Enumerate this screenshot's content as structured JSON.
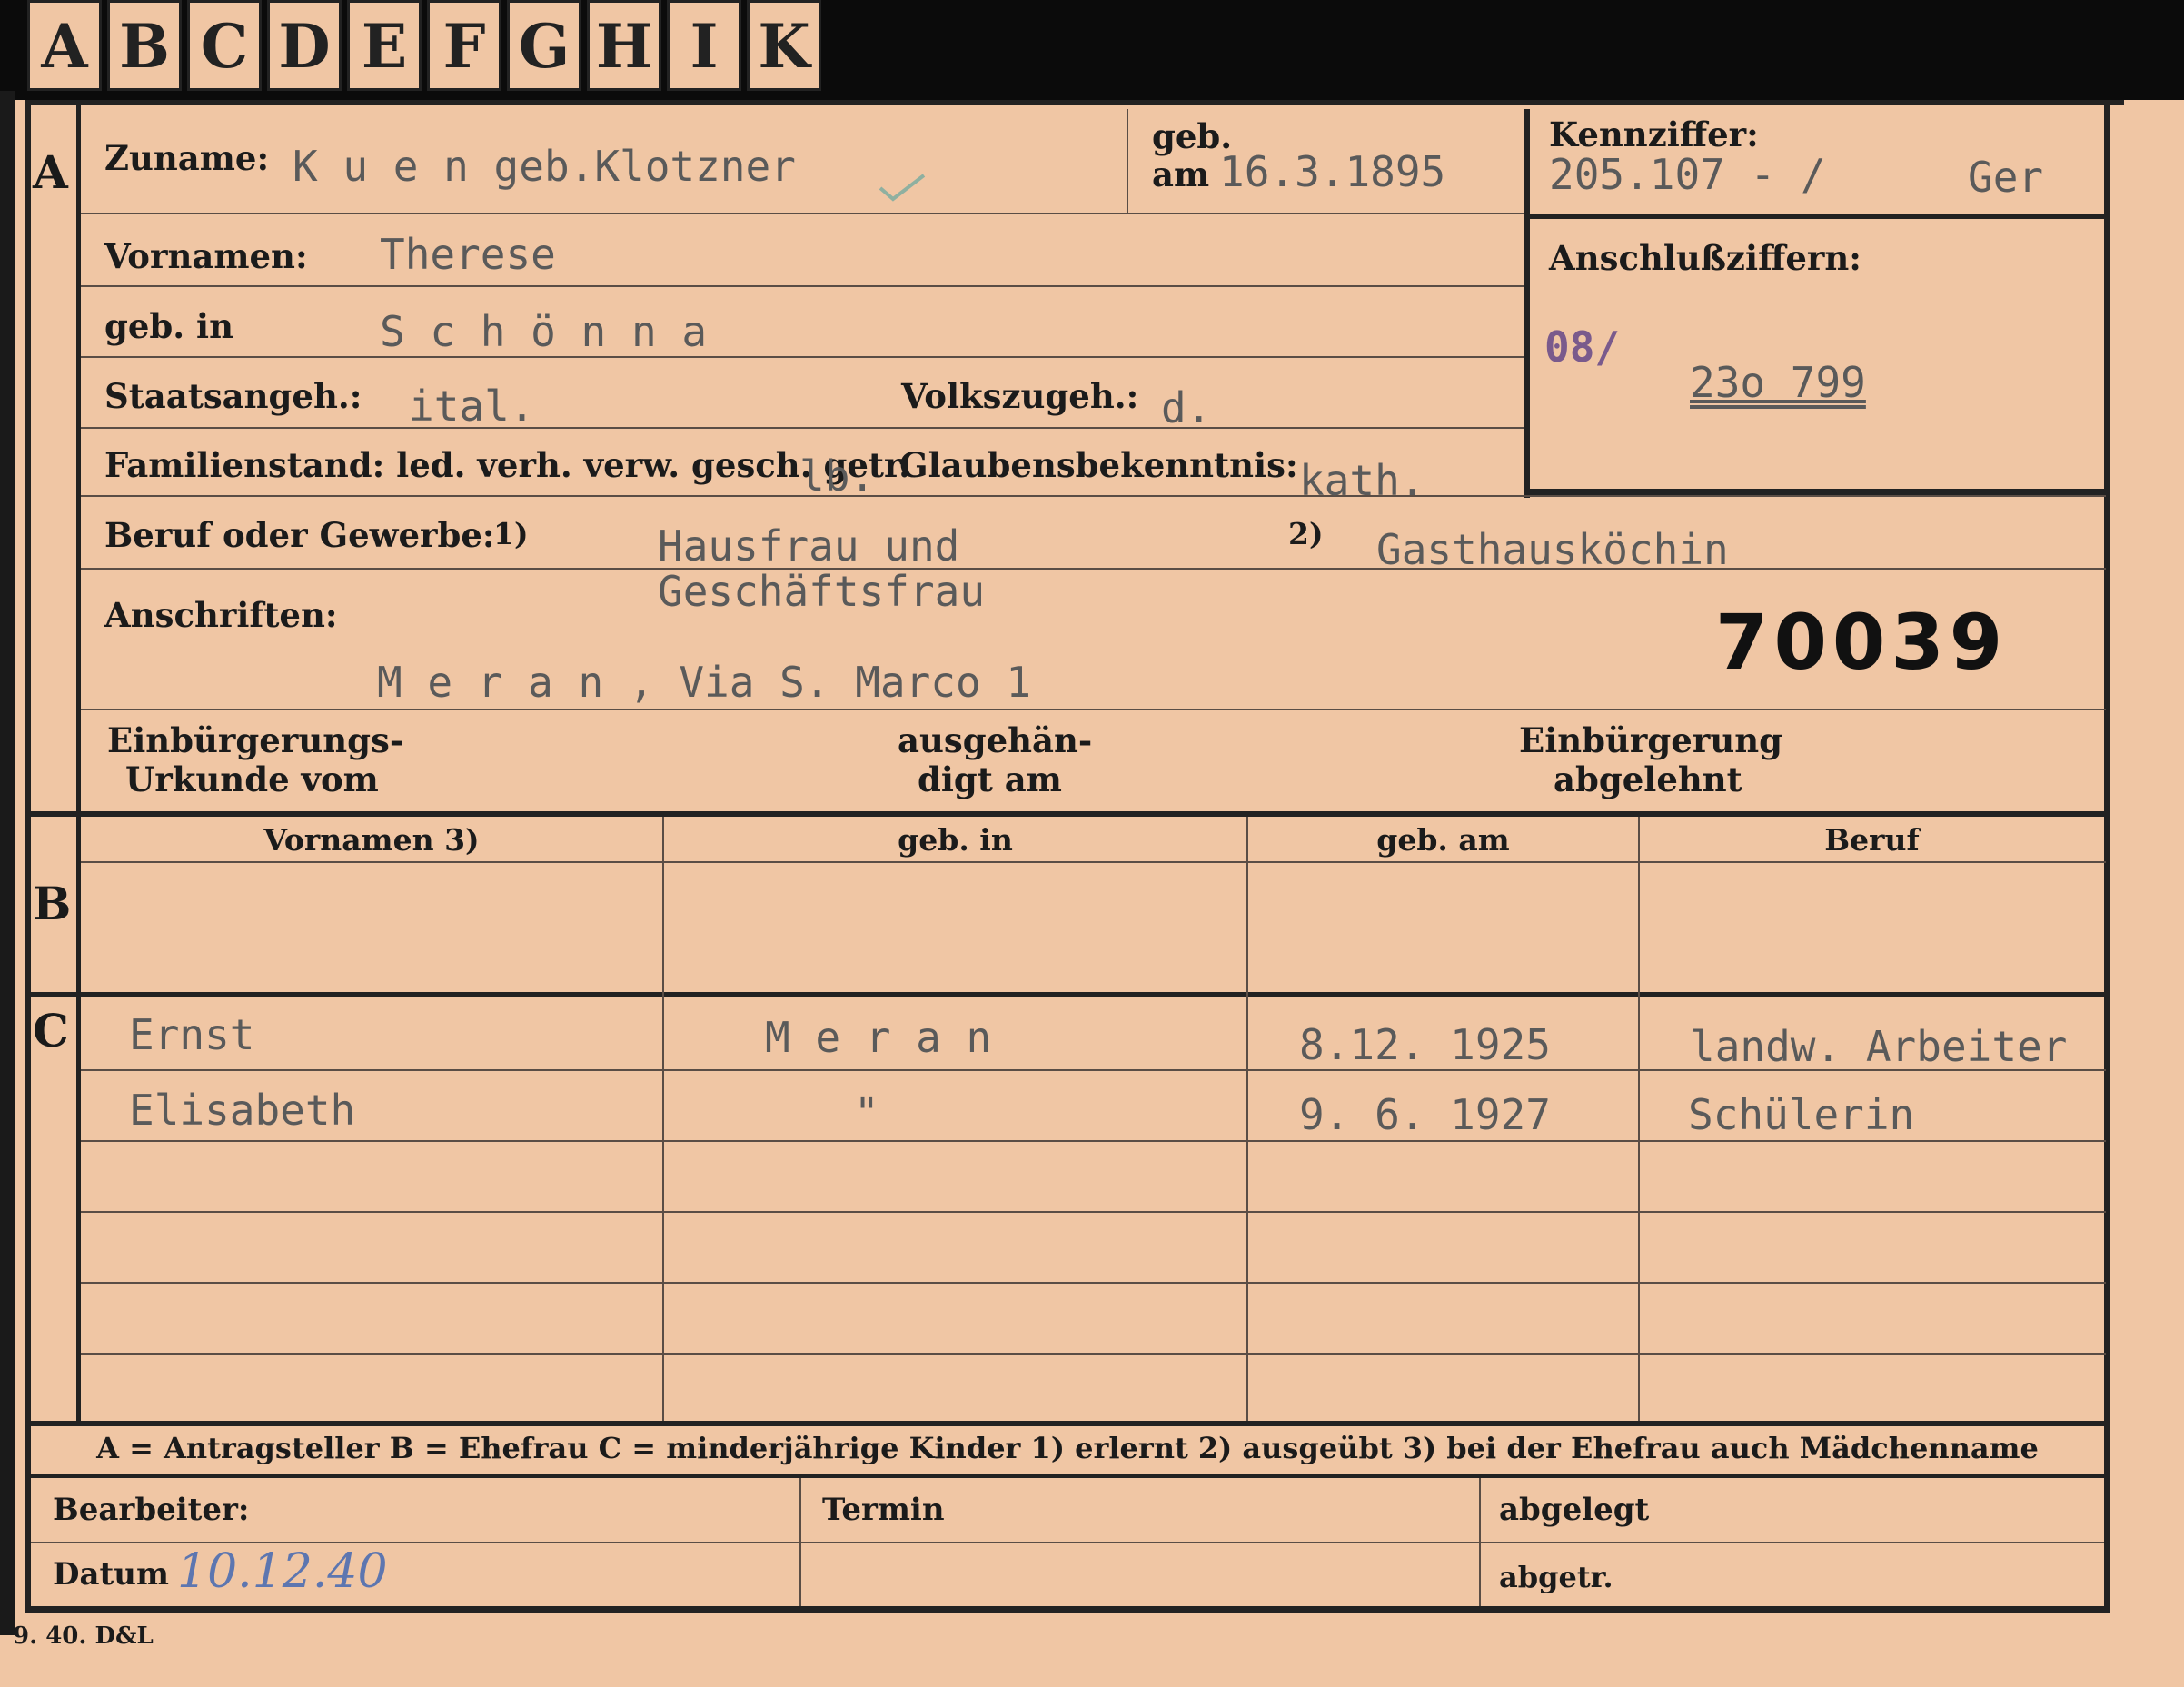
{
  "tabs": [
    "A",
    "B",
    "C",
    "D",
    "E",
    "F",
    "G",
    "H",
    "I",
    "K"
  ],
  "sections": {
    "a": "A",
    "b": "B",
    "c": "C"
  },
  "applicant": {
    "surname_label": "Zuname:",
    "surname_value": "K u e n geb.Klotzner",
    "born_label_1": "geb.",
    "born_label_2": "am",
    "born_value": "16.3.1895",
    "kennziffer_label": "Kennziffer:",
    "kennziffer_value": "205.107 - /",
    "kennziffer_suffix": "Ger",
    "firstname_label": "Vornamen:",
    "firstname_value": "Therese",
    "birthplace_label": "geb. in",
    "birthplace_value": "S c h ö n n a",
    "anschluss_label": "Anschlußziffern:",
    "anschluss_prefix": "08/",
    "anschluss_value": "23o 799",
    "citizenship_label": "Staatsangeh.:",
    "citizenship_value": "ital.",
    "ethnicity_label": "Volkszugeh.:",
    "ethnicity_value": "d.",
    "marital_label": "Familienstand: led. verh. verw. gesch. getr.",
    "marital_value": "lb.",
    "religion_label": "Glaubensbekenntnis:",
    "religion_value": "kath.",
    "profession_label": "Beruf oder Gewerbe:",
    "profession_note1": "1)",
    "profession_value1_line1": "Hausfrau und",
    "profession_value1_line2": "Geschäftsfrau",
    "profession_note2": "2)",
    "profession_value2": "Gasthausköchin",
    "address_label": "Anschriften:",
    "address_value": "M e r a n , Via S. Marco 1",
    "stamp_number": "70039",
    "naturalization_label_1": "Einbürgerungs-",
    "naturalization_label_2": "Urkunde vom",
    "handed_label_1": "ausgehän-",
    "handed_label_2": "digt am",
    "rejected_label_1": "Einbürgerung",
    "rejected_label_2": "abgelehnt"
  },
  "spouse_headers": {
    "firstnames": "Vornamen 3)",
    "birthplace": "geb. in",
    "birthdate": "geb. am",
    "profession": "Beruf"
  },
  "children": [
    {
      "name": "Ernst",
      "place": "M e r a n",
      "date": "8.12. 1925",
      "profession": "landw. Arbeiter"
    },
    {
      "name": "Elisabeth",
      "place": "\"",
      "date": "9. 6. 1927",
      "profession": "Schülerin"
    }
  ],
  "legend": "A = Antragsteller   B = Ehefrau   C = minderjährige Kinder   1) erlernt   2) ausgeübt   3) bei der Ehefrau auch Mädchenname",
  "footer": {
    "editor_label": "Bearbeiter:",
    "date_label": "Datum",
    "date_value": "10.12.40",
    "deadline_label": "Termin",
    "filed_label": "abgelegt",
    "abgetr_label": "abgetr.",
    "print_code": "9. 40. D&L"
  }
}
